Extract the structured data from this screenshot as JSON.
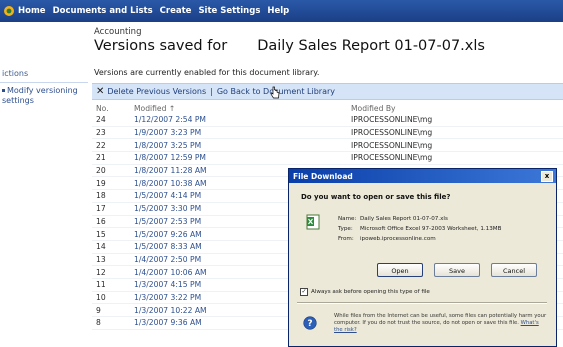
{
  "topnav": {
    "items": [
      "Home",
      "Documents and Lists",
      "Create",
      "Site Settings",
      "Help"
    ]
  },
  "header": {
    "breadcrumb": "Accounting",
    "title_prefix": "Versions saved for",
    "document_name": "Daily Sales Report 01-07-07.xls"
  },
  "leftrail": {
    "heading": "ictions",
    "link_label": "Modify versioning settings"
  },
  "info_text": "Versions are currently enabled for this document library.",
  "toolbar": {
    "delete_label": "Delete Previous Versions",
    "separator": "|",
    "back_label": "Go Back to Document Library"
  },
  "table": {
    "headers": {
      "no": "No.",
      "modified": "Modified ↑",
      "modified_by": "Modified By"
    },
    "rows": [
      {
        "no": "24",
        "modified": "1/12/2007 2:54 PM",
        "by": "IPROCESSONLINE\\mg"
      },
      {
        "no": "23",
        "modified": "1/9/2007 3:23 PM",
        "by": "IPROCESSONLINE\\mg"
      },
      {
        "no": "22",
        "modified": "1/8/2007 3:25 PM",
        "by": "IPROCESSONLINE\\mg"
      },
      {
        "no": "21",
        "modified": "1/8/2007 12:59 PM",
        "by": "IPROCESSONLINE\\mg"
      },
      {
        "no": "20",
        "modified": "1/8/2007 11:28 AM",
        "by": ""
      },
      {
        "no": "19",
        "modified": "1/8/2007 10:38 AM",
        "by": ""
      },
      {
        "no": "18",
        "modified": "1/5/2007 4:14 PM",
        "by": ""
      },
      {
        "no": "17",
        "modified": "1/5/2007 3:30 PM",
        "by": ""
      },
      {
        "no": "16",
        "modified": "1/5/2007 2:53 PM",
        "by": ""
      },
      {
        "no": "15",
        "modified": "1/5/2007 9:26 AM",
        "by": ""
      },
      {
        "no": "14",
        "modified": "1/5/2007 8:33 AM",
        "by": ""
      },
      {
        "no": "13",
        "modified": "1/4/2007 2:50 PM",
        "by": ""
      },
      {
        "no": "12",
        "modified": "1/4/2007 10:06 AM",
        "by": ""
      },
      {
        "no": "11",
        "modified": "1/3/2007 4:15 PM",
        "by": ""
      },
      {
        "no": "10",
        "modified": "1/3/2007 3:22 PM",
        "by": ""
      },
      {
        "no": "9",
        "modified": "1/3/2007 10:22 AM",
        "by": ""
      },
      {
        "no": "8",
        "modified": "1/3/2007 9:36 AM",
        "by": ""
      }
    ]
  },
  "dialog": {
    "title": "File Download",
    "close_glyph": "x",
    "question": "Do you want to open or save this file?",
    "name_label": "Name:",
    "name_value": "Daily Sales Report 01-07-07.xls",
    "type_label": "Type:",
    "type_value": "Microsoft Office Excel 97-2003 Worksheet, 1.13MB",
    "from_label": "From:",
    "from_value": "ipoweb.iprocessonline.com",
    "open_label": "Open",
    "save_label": "Save",
    "cancel_label": "Cancel",
    "checkbox_label": "Always ask before opening this type of file",
    "checkbox_checked": true,
    "warning_text": "While files from the Internet can be useful, some files can potentially harm your computer. If you do not trust the source, do not open or save this file.",
    "warning_link": "What's the risk?"
  },
  "colors": {
    "topnav": "#1b3f86",
    "toolbar": "#d6e4f7",
    "dialog_title": "#0a3ea8",
    "dialog_body": "#ece9d8"
  }
}
